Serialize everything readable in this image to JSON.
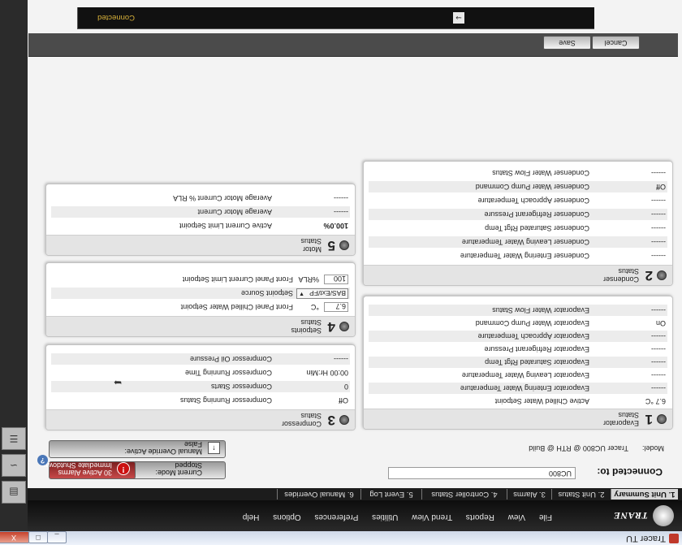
{
  "window": {
    "title": "Tracer TU",
    "min": "_",
    "max": "□",
    "close": "X"
  },
  "menu": [
    "File",
    "View",
    "Reports",
    "Trend View",
    "Utilities",
    "Preferences",
    "Options",
    "Help"
  ],
  "logo": "TRANE",
  "tabs": [
    "1. Unit Summary",
    "2. Unit Status",
    "3. Alarms",
    "4. Controller Status",
    "5. Event Log",
    "6. Manual Overrides"
  ],
  "connection": {
    "label": "Connected to:",
    "value": "UC800",
    "model_label": "Model:",
    "model_value": "Tracer UC800 @ RTH @ Build"
  },
  "status_buttons": {
    "current_mode": {
      "line1": "Current Mode:",
      "line2": "Stopped"
    },
    "alarms": {
      "line1": "30 Active Alarms",
      "line2": "Immediate Shutdown"
    },
    "override": {
      "line1": "Manual Override Active:",
      "line2": "False"
    },
    "help": "?"
  },
  "panels": {
    "evaporator": {
      "number": "1",
      "title1": "Evaporator",
      "title2": "Status",
      "rows": [
        {
          "value": "6.7 °C",
          "label": "Active Chilled Water Setpoint"
        },
        {
          "value": "------",
          "label": "Evaporator Entering Water Temperature"
        },
        {
          "value": "------",
          "label": "Evaporator Leaving Water Temperature"
        },
        {
          "value": "------",
          "label": "Evaporator Saturated Rfgt Temp"
        },
        {
          "value": "------",
          "label": "Evaporator Refrigerant Pressure"
        },
        {
          "value": "------",
          "label": "Evaporator Approach Temperature"
        },
        {
          "value": "On",
          "label": "Evaporator Water Pump Command"
        },
        {
          "value": "------",
          "label": "Evaporator Water Flow Status"
        }
      ]
    },
    "condenser": {
      "number": "2",
      "title1": "Condenser",
      "title2": "Status",
      "rows": [
        {
          "value": "------",
          "label": "Condenser Entering Water Temperature"
        },
        {
          "value": "------",
          "label": "Condenser Leaving Water Temperature"
        },
        {
          "value": "------",
          "label": "Condenser Saturated Rfgt Temp"
        },
        {
          "value": "------",
          "label": "Condenser Refrigerant Pressure"
        },
        {
          "value": "------",
          "label": "Condenser Approach Temperature"
        },
        {
          "value": "Off",
          "label": "Condenser Water Pump Command"
        },
        {
          "value": "------",
          "label": "Condenser Water Flow Status"
        }
      ]
    },
    "compressor": {
      "number": "3",
      "title1": "Compressor",
      "title2": "Status",
      "rows": [
        {
          "value": "Off",
          "label": "Compressor Running Status"
        },
        {
          "value": "0",
          "label": "Compressor Starts"
        },
        {
          "value": "00:00 Hr:Min",
          "label": "Compressor Running Time"
        },
        {
          "value": "------",
          "label": "Compressor Oil Pressure"
        }
      ]
    },
    "setpoints": {
      "number": "4",
      "title1": "Setpoints",
      "title2": "Status",
      "rows": [
        {
          "value": "6.7",
          "unit": "°C",
          "label": "Front Panel Chilled Water Setpoint"
        },
        {
          "value": "BAS/Ext/FP",
          "label": "Setpoint Source"
        },
        {
          "value": "100",
          "unit": "%RLA",
          "label": "Front Panel Current Limit Setpoint"
        }
      ]
    },
    "motor": {
      "number": "5",
      "title1": "Motor",
      "title2": "Status",
      "rows": [
        {
          "value": "100.0%",
          "label": "Active Current Limit Setpoint"
        },
        {
          "value": "------",
          "label": "Average Motor Current"
        },
        {
          "value": "------",
          "label": "Average Motor Current % RLA"
        }
      ]
    }
  },
  "actions": {
    "cancel": "Cancel",
    "save": "Save"
  },
  "statusbar": {
    "text": "Connected"
  },
  "colors": {
    "status_text": "#d8b13a",
    "alarm": "#cc1111"
  }
}
